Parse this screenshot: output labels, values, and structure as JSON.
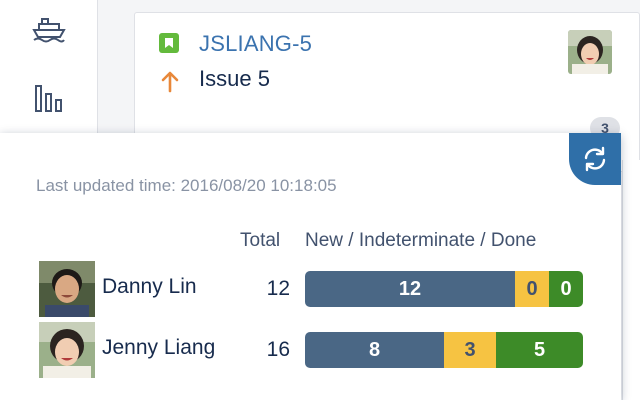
{
  "colors": {
    "new": "#4a6785",
    "indeterminate": "#f6c342",
    "done": "#3d8b28",
    "link": "#3b73af",
    "refresh_button": "#2f6fa8"
  },
  "rail": {
    "items": [
      {
        "icon": "ship-icon"
      },
      {
        "icon": "bar-chart-icon"
      }
    ]
  },
  "card": {
    "type_icon": "story-icon",
    "issue_key": "JSLIANG-5",
    "priority_icon": "arrow-up-icon",
    "summary": "Issue 5",
    "count_badge": "3"
  },
  "popup": {
    "refresh_icon": "refresh-icon",
    "last_updated": "Last updated time: 2016/08/20 10:18:05",
    "columns": {
      "total": "Total",
      "status": "New / Indeterminate / Done"
    },
    "rows": [
      {
        "name": "Danny Lin",
        "total": "12",
        "new": 12,
        "indeterminate": 0,
        "done": 0
      },
      {
        "name": "Jenny Liang",
        "total": "16",
        "new": 8,
        "indeterminate": 3,
        "done": 5
      }
    ]
  }
}
